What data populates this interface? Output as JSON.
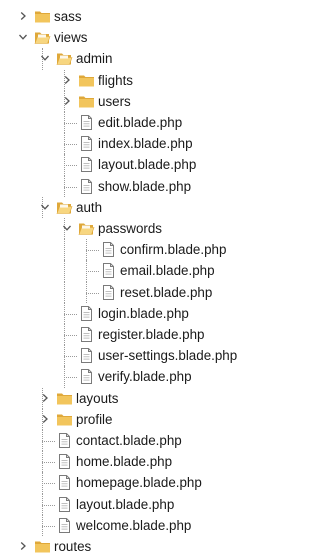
{
  "tree": [
    {
      "label": "sass",
      "type": "folder",
      "depth": 0,
      "expanded": false,
      "guide_cont": []
    },
    {
      "label": "views",
      "type": "folder",
      "depth": 0,
      "expanded": true,
      "guide_cont": []
    },
    {
      "label": "admin",
      "type": "folder",
      "depth": 1,
      "expanded": true,
      "guide_cont": [
        false
      ]
    },
    {
      "label": "flights",
      "type": "folder",
      "depth": 2,
      "expanded": false,
      "guide_cont": [
        false,
        true
      ]
    },
    {
      "label": "users",
      "type": "folder",
      "depth": 2,
      "expanded": false,
      "guide_cont": [
        false,
        true
      ]
    },
    {
      "label": "edit.blade.php",
      "type": "file",
      "depth": 2,
      "guide_cont": [
        false,
        true
      ]
    },
    {
      "label": "index.blade.php",
      "type": "file",
      "depth": 2,
      "guide_cont": [
        false,
        true
      ]
    },
    {
      "label": "layout.blade.php",
      "type": "file",
      "depth": 2,
      "guide_cont": [
        false,
        true
      ]
    },
    {
      "label": "show.blade.php",
      "type": "file",
      "depth": 2,
      "guide_cont": [
        false,
        true
      ]
    },
    {
      "label": "auth",
      "type": "folder",
      "depth": 1,
      "expanded": true,
      "guide_cont": [
        false
      ]
    },
    {
      "label": "passwords",
      "type": "folder",
      "depth": 2,
      "expanded": true,
      "guide_cont": [
        false,
        true
      ]
    },
    {
      "label": "confirm.blade.php",
      "type": "file",
      "depth": 3,
      "guide_cont": [
        false,
        true,
        true
      ]
    },
    {
      "label": "email.blade.php",
      "type": "file",
      "depth": 3,
      "guide_cont": [
        false,
        true,
        true
      ]
    },
    {
      "label": "reset.blade.php",
      "type": "file",
      "depth": 3,
      "guide_cont": [
        false,
        true,
        true
      ]
    },
    {
      "label": "login.blade.php",
      "type": "file",
      "depth": 2,
      "guide_cont": [
        false,
        true
      ]
    },
    {
      "label": "register.blade.php",
      "type": "file",
      "depth": 2,
      "guide_cont": [
        false,
        true
      ]
    },
    {
      "label": "user-settings.blade.php",
      "type": "file",
      "depth": 2,
      "guide_cont": [
        false,
        true
      ]
    },
    {
      "label": "verify.blade.php",
      "type": "file",
      "depth": 2,
      "guide_cont": [
        false,
        true
      ]
    },
    {
      "label": "layouts",
      "type": "folder",
      "depth": 1,
      "expanded": false,
      "guide_cont": [
        false
      ]
    },
    {
      "label": "profile",
      "type": "folder",
      "depth": 1,
      "expanded": false,
      "guide_cont": [
        false
      ]
    },
    {
      "label": "contact.blade.php",
      "type": "file",
      "depth": 1,
      "guide_cont": [
        false
      ]
    },
    {
      "label": "home.blade.php",
      "type": "file",
      "depth": 1,
      "guide_cont": [
        false
      ]
    },
    {
      "label": "homepage.blade.php",
      "type": "file",
      "depth": 1,
      "guide_cont": [
        false
      ]
    },
    {
      "label": "layout.blade.php",
      "type": "file",
      "depth": 1,
      "guide_cont": [
        false
      ]
    },
    {
      "label": "welcome.blade.php",
      "type": "file",
      "depth": 1,
      "guide_cont": [
        false
      ]
    },
    {
      "label": "routes",
      "type": "folder",
      "depth": 0,
      "expanded": false,
      "guide_cont": []
    }
  ],
  "colors": {
    "folder_body": "#f2c55c",
    "folder_tab": "#dfa83a",
    "folder_open_front": "#f7d680",
    "file_border": "#7a7a7a",
    "file_fill": "#ffffff",
    "chevron": "#555555",
    "guides": "#9a9a9a",
    "text": "#1a1a1a"
  },
  "icons": {
    "folder": "folder-icon",
    "folder_open": "folder-open-icon",
    "file": "file-icon",
    "chevron_right": "chevron-right-icon",
    "chevron_down": "chevron-down-icon"
  }
}
